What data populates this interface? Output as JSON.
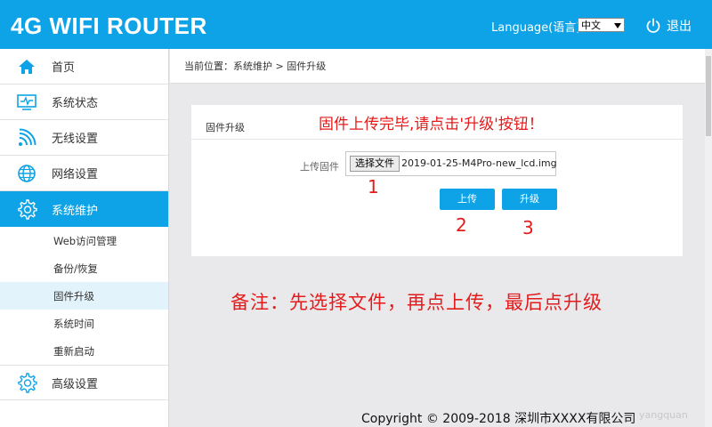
{
  "header": {
    "brand": "4G WIFI ROUTER",
    "language_label": "Language(语言) :",
    "language_value": "中文",
    "logout_label": "退出",
    "bg_color": "#0ea3e6"
  },
  "sidebar": {
    "items": [
      {
        "label": "首页",
        "icon": "home-icon"
      },
      {
        "label": "系统状态",
        "icon": "monitor-icon"
      },
      {
        "label": "无线设置",
        "icon": "wifi-icon"
      },
      {
        "label": "网络设置",
        "icon": "globe-icon"
      },
      {
        "label": "系统维护",
        "icon": "gear-icon",
        "active": true
      }
    ],
    "sub_items": [
      {
        "label": "Web访问管理"
      },
      {
        "label": "备份/恢复"
      },
      {
        "label": "固件升级",
        "active": true
      },
      {
        "label": "系统时间"
      },
      {
        "label": "重新启动"
      }
    ],
    "advanced": {
      "label": "高级设置",
      "icon": "gear-icon"
    }
  },
  "breadcrumb": "当前位置：系统维护 > 固件升级",
  "panel": {
    "title": "固件升级",
    "upload_label": "上传固件",
    "choose_file_label": "选择文件",
    "file_name": "2019-01-25-M4Pro-new_lcd.img",
    "upload_button": "上传",
    "upgrade_button": "升级"
  },
  "annotations": {
    "title": "固件上传完毕,请点击'升级'按钮！",
    "step1": "1",
    "step2": "2",
    "step3": "3",
    "note": "备注：先选择文件，再点上传，最后点升级",
    "color": "#e31b1b"
  },
  "footer": "Copyright © 2009-2018 深圳市XXXX有限公司",
  "watermark": "yangquan"
}
